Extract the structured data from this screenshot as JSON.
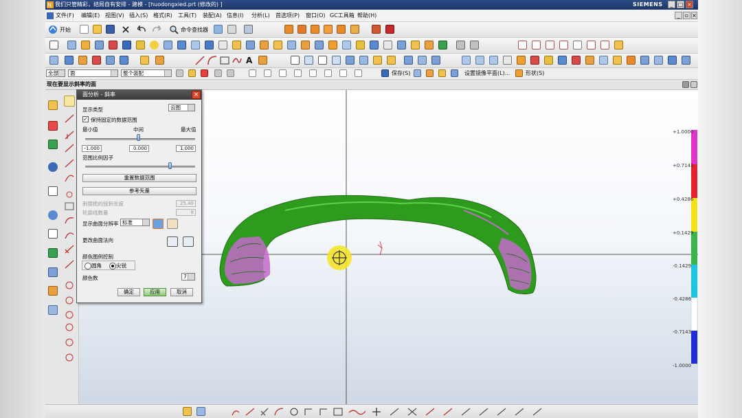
{
  "window": {
    "title": "我们只管精彩，结局自有安排 - 建模 - [huodongxied.prt (修改的) ]",
    "brand": "SIEMENS"
  },
  "menu": [
    "文件(F)",
    "编辑(E)",
    "视图(V)",
    "插入(S)",
    "格式(R)",
    "工具(T)",
    "装配(A)",
    "信息(I)",
    "分析(L)",
    "首选项(P)",
    "窗口(O)",
    "GC工具箱",
    "帮助(H)"
  ],
  "toolbar": {
    "start_label": "开始",
    "command_finder": "命令查找器",
    "save_label": "保存(S)",
    "mirror_plane": "设置镜像平面(L)...",
    "shape_label": "形状(S)"
  },
  "selection": {
    "filter": "全部",
    "type": "面",
    "scope": "整个装配"
  },
  "cue_line": "现在要显示斜率的面",
  "dialog": {
    "title": "面分析 - 斜率",
    "display_type_label": "显示类型",
    "display_type_value": "云图",
    "keep_range_label": "保持固定的数据范围",
    "keep_range_checked": true,
    "min_label": "最小值",
    "mid_label": "中间",
    "max_label": "最大值",
    "min_value": "-1.000",
    "mid_value": "0.000",
    "max_value": "1.000",
    "range_scale_label": "范围比例因子",
    "range_scale_fraction": 0.77,
    "reset_range_button": "重置数据范围",
    "reference_vector_button": "参考矢量",
    "spike_length_label": "刺猬梳的锐刺长度",
    "spike_length_value": "25.40",
    "contour_count_label": "轮廓线数量",
    "contour_count_value": "8",
    "resolution_label": "显示曲面分辨率",
    "resolution_value": "标准",
    "change_normal_label": "更改曲面法向",
    "color_legend_label": "颜色图例控制",
    "radio_rounded": "圆角",
    "radio_sharp": "尖锐",
    "radio_selected": "sharp",
    "color_count_label": "颜色数",
    "color_count_value": "7",
    "ok_button": "确定",
    "apply_button": "应用",
    "cancel_button": "取消"
  },
  "legend": {
    "labels": [
      "+1.0000",
      "+0.7143",
      "+0.4286",
      "+0.1429",
      "-0.1429",
      "-0.4286",
      "-0.7143",
      "-1.0000"
    ],
    "colors": [
      "#e033cc",
      "#e8222a",
      "#f4e31c",
      "#39b54a",
      "#1cc4e8",
      "#ffffff",
      "#1e2fd6"
    ]
  },
  "model": {
    "body_color": "#2e9b1f",
    "highlight_color": "#c26bc9"
  }
}
